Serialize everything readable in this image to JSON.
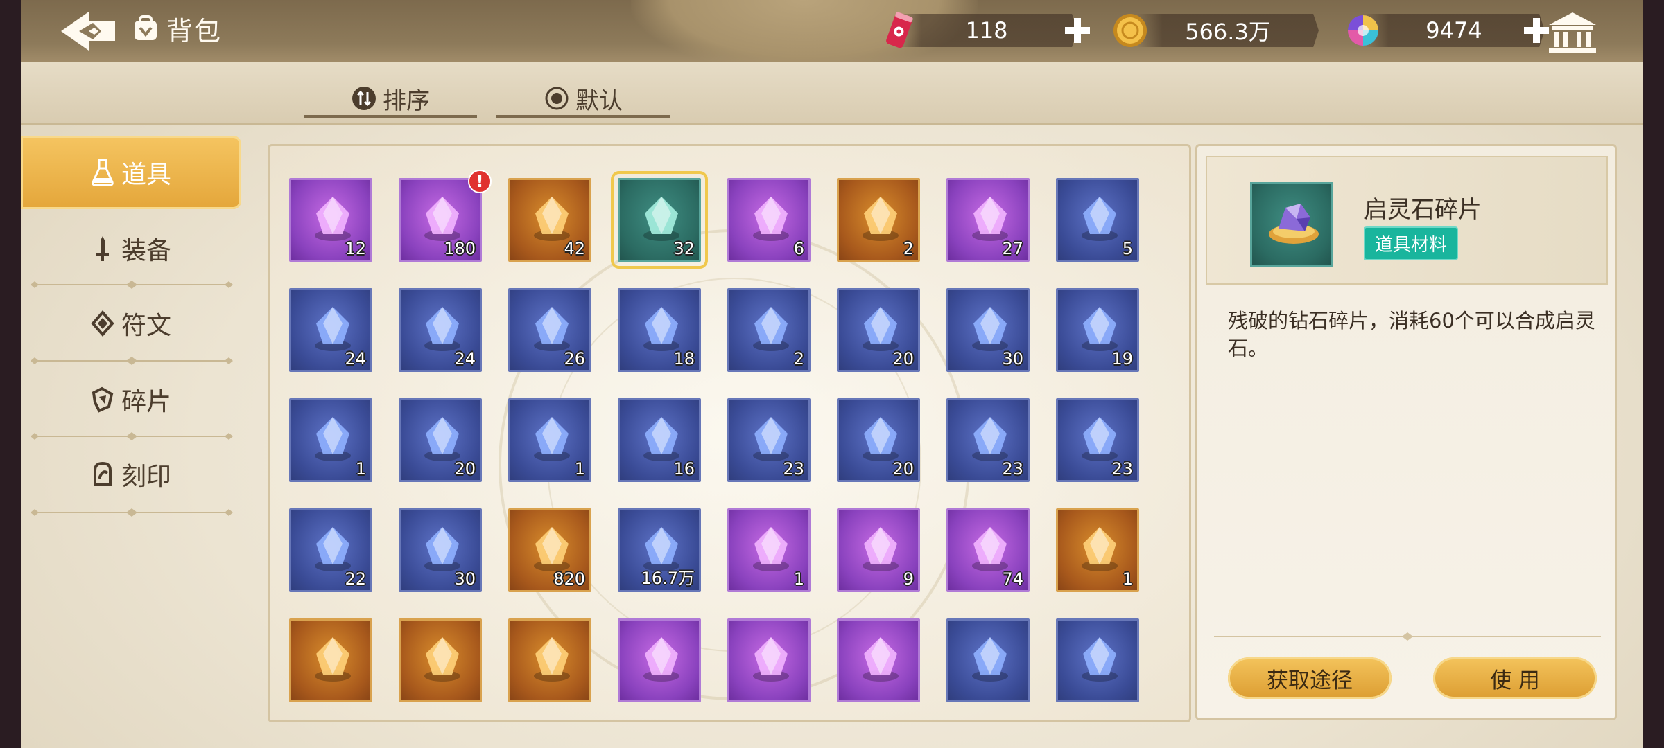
{
  "header": {
    "title": "背包",
    "currencies": [
      {
        "name": "stamina",
        "value": "118",
        "icon": "energy-can-icon",
        "has_plus": true
      },
      {
        "name": "gold",
        "value": "566.3万",
        "icon": "gold-coin-icon",
        "has_plus": false
      },
      {
        "name": "gem",
        "value": "9474",
        "icon": "rainbow-gem-icon",
        "has_plus": true
      }
    ]
  },
  "filters": {
    "sort_label": "排序",
    "default_label": "默认"
  },
  "categories": [
    {
      "label": "道具",
      "active": true,
      "icon": "potion-flask-icon"
    },
    {
      "label": "装备",
      "active": false,
      "icon": "sword-icon"
    },
    {
      "label": "符文",
      "active": false,
      "icon": "rune-icon"
    },
    {
      "label": "碎片",
      "active": false,
      "icon": "fragment-icon"
    },
    {
      "label": "刻印",
      "active": false,
      "icon": "seal-icon"
    }
  ],
  "items": [
    {
      "count": "12",
      "rarity": "purple",
      "icon": "mystery-card-icon"
    },
    {
      "count": "180",
      "rarity": "purple",
      "icon": "character-silhouette-card-icon",
      "alert": "!"
    },
    {
      "count": "42",
      "rarity": "gold",
      "icon": "mystery-card-icon"
    },
    {
      "count": "32",
      "rarity": "teal",
      "icon": "diamond-fragment-icon",
      "selected": true
    },
    {
      "count": "6",
      "rarity": "purple",
      "icon": "flower-bouquet-icon"
    },
    {
      "count": "2",
      "rarity": "gold",
      "icon": "gift-box-icon"
    },
    {
      "count": "27",
      "rarity": "purple",
      "icon": "robot-cat-icon"
    },
    {
      "count": "5",
      "rarity": "blue",
      "icon": "green-crystal-icon"
    },
    {
      "count": "24",
      "rarity": "blue",
      "icon": "stone-chunk-icon"
    },
    {
      "count": "24",
      "rarity": "blue",
      "icon": "leaf-branch-icon"
    },
    {
      "count": "26",
      "rarity": "blue",
      "icon": "dark-ore-icon"
    },
    {
      "count": "18",
      "rarity": "blue",
      "icon": "water-bowl-icon"
    },
    {
      "count": "2",
      "rarity": "blue",
      "icon": "orange-potion-icon"
    },
    {
      "count": "20",
      "rarity": "blue",
      "icon": "pink-teapot-icon"
    },
    {
      "count": "30",
      "rarity": "blue",
      "icon": "red-potion-icon"
    },
    {
      "count": "19",
      "rarity": "blue",
      "icon": "grain-pile-icon"
    },
    {
      "count": "1",
      "rarity": "blue",
      "icon": "blue-cloth-icon"
    },
    {
      "count": "20",
      "rarity": "blue",
      "icon": "bread-rolls-icon"
    },
    {
      "count": "1",
      "rarity": "blue",
      "icon": "golden-apple-icon"
    },
    {
      "count": "16",
      "rarity": "blue",
      "icon": "umbrella-icon"
    },
    {
      "count": "23",
      "rarity": "blue",
      "icon": "lighter-icon"
    },
    {
      "count": "20",
      "rarity": "blue",
      "icon": "open-book-icon"
    },
    {
      "count": "23",
      "rarity": "blue",
      "icon": "closed-book-icon"
    },
    {
      "count": "23",
      "rarity": "blue",
      "icon": "milk-carton-icon"
    },
    {
      "count": "22",
      "rarity": "blue",
      "icon": "medal-icon"
    },
    {
      "count": "30",
      "rarity": "blue",
      "icon": "pink-pillow-icon"
    },
    {
      "count": "820",
      "rarity": "gold",
      "icon": "blue-gem-icon"
    },
    {
      "count": "16.7万",
      "rarity": "blue",
      "icon": "white-crystal-icon"
    },
    {
      "count": "1",
      "rarity": "purple",
      "icon": "diamond-ring-icon"
    },
    {
      "count": "9",
      "rarity": "purple",
      "icon": "dagger-icon"
    },
    {
      "count": "74",
      "rarity": "purple",
      "icon": "fashion-tag-icon"
    },
    {
      "count": "1",
      "rarity": "gold",
      "icon": "dynamite-icon"
    },
    {
      "count": "",
      "rarity": "gold",
      "icon": "red-crystal-icon"
    },
    {
      "count": "",
      "rarity": "gold",
      "icon": "star-badge-icon"
    },
    {
      "count": "",
      "rarity": "gold",
      "icon": "ticket-card-icon"
    },
    {
      "count": "",
      "rarity": "purple",
      "icon": "dynamite-icon"
    },
    {
      "count": "",
      "rarity": "purple",
      "icon": "golden-key-icon"
    },
    {
      "count": "",
      "rarity": "purple",
      "icon": "tools-icon"
    },
    {
      "count": "",
      "rarity": "blue",
      "icon": "teal-swirl-coin-icon"
    },
    {
      "count": "",
      "rarity": "blue",
      "icon": "blue-swirl-coin-icon"
    }
  ],
  "detail": {
    "name": "启灵石碎片",
    "tag": "道具材料",
    "description": "残破的钻石碎片，消耗60个可以合成启灵石。",
    "source_button": "获取途径",
    "use_button": "使 用"
  },
  "colors": {
    "accent_gold": "#e4a63a",
    "tag_teal": "#19b59d",
    "alert_red": "#e0312f"
  }
}
